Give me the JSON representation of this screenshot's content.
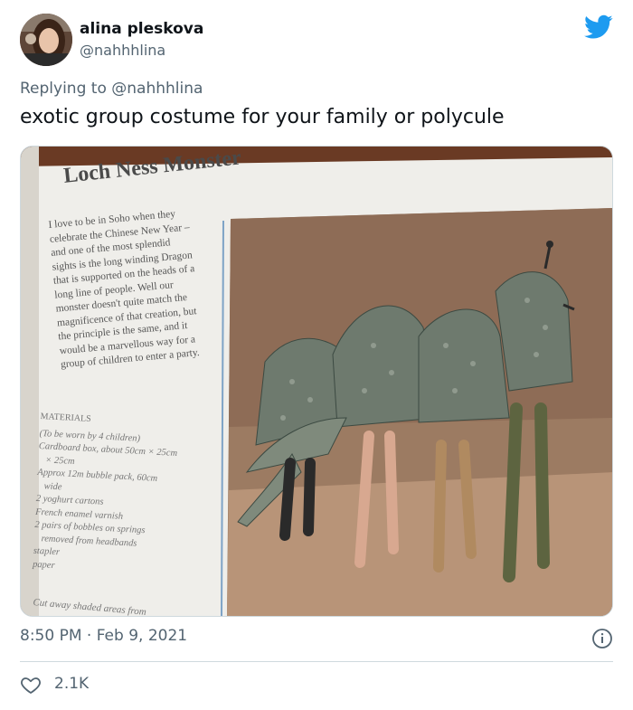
{
  "author": {
    "display_name": "alina pleskova",
    "handle": "@nahhhlina"
  },
  "reply": {
    "prefix": "Replying to",
    "handle": "@nahhhlina"
  },
  "tweet": {
    "text": "exotic group costume for your family or polycule",
    "timestamp": "8:50 PM · Feb 9, 2021",
    "likes": "2.1K"
  },
  "photo": {
    "heading": "Loch Ness Monster",
    "body_lines": [
      "I love to be in Soho when they",
      "celebrate the Chinese New Year –",
      "and one of the most splendid",
      "sights is the long winding Dragon",
      "that is supported on the heads of a",
      "long line of people. Well our",
      "monster doesn't quite match the",
      "magnificence of that creation, but",
      "the principle is the same, and it",
      "would be a marvellous way for a",
      "group of children to enter a party."
    ],
    "materials_title": "MATERIALS",
    "materials_lines": [
      "(To be worn by 4 children)",
      "Cardboard box, about 50cm × 25cm",
      "× 25cm",
      "Approx 12m bubble pack, 60cm",
      "wide",
      "2 yoghurt cartons",
      "French enamel varnish",
      "2 pairs of bobbles on springs",
      "removed from headbands",
      "stapler",
      "paper"
    ],
    "footer_line": "Cut away shaded areas from"
  },
  "colors": {
    "twitter_blue": "#1d9bf0",
    "text_primary": "#0f1419",
    "text_secondary": "#536471",
    "border": "#cfd9de"
  }
}
